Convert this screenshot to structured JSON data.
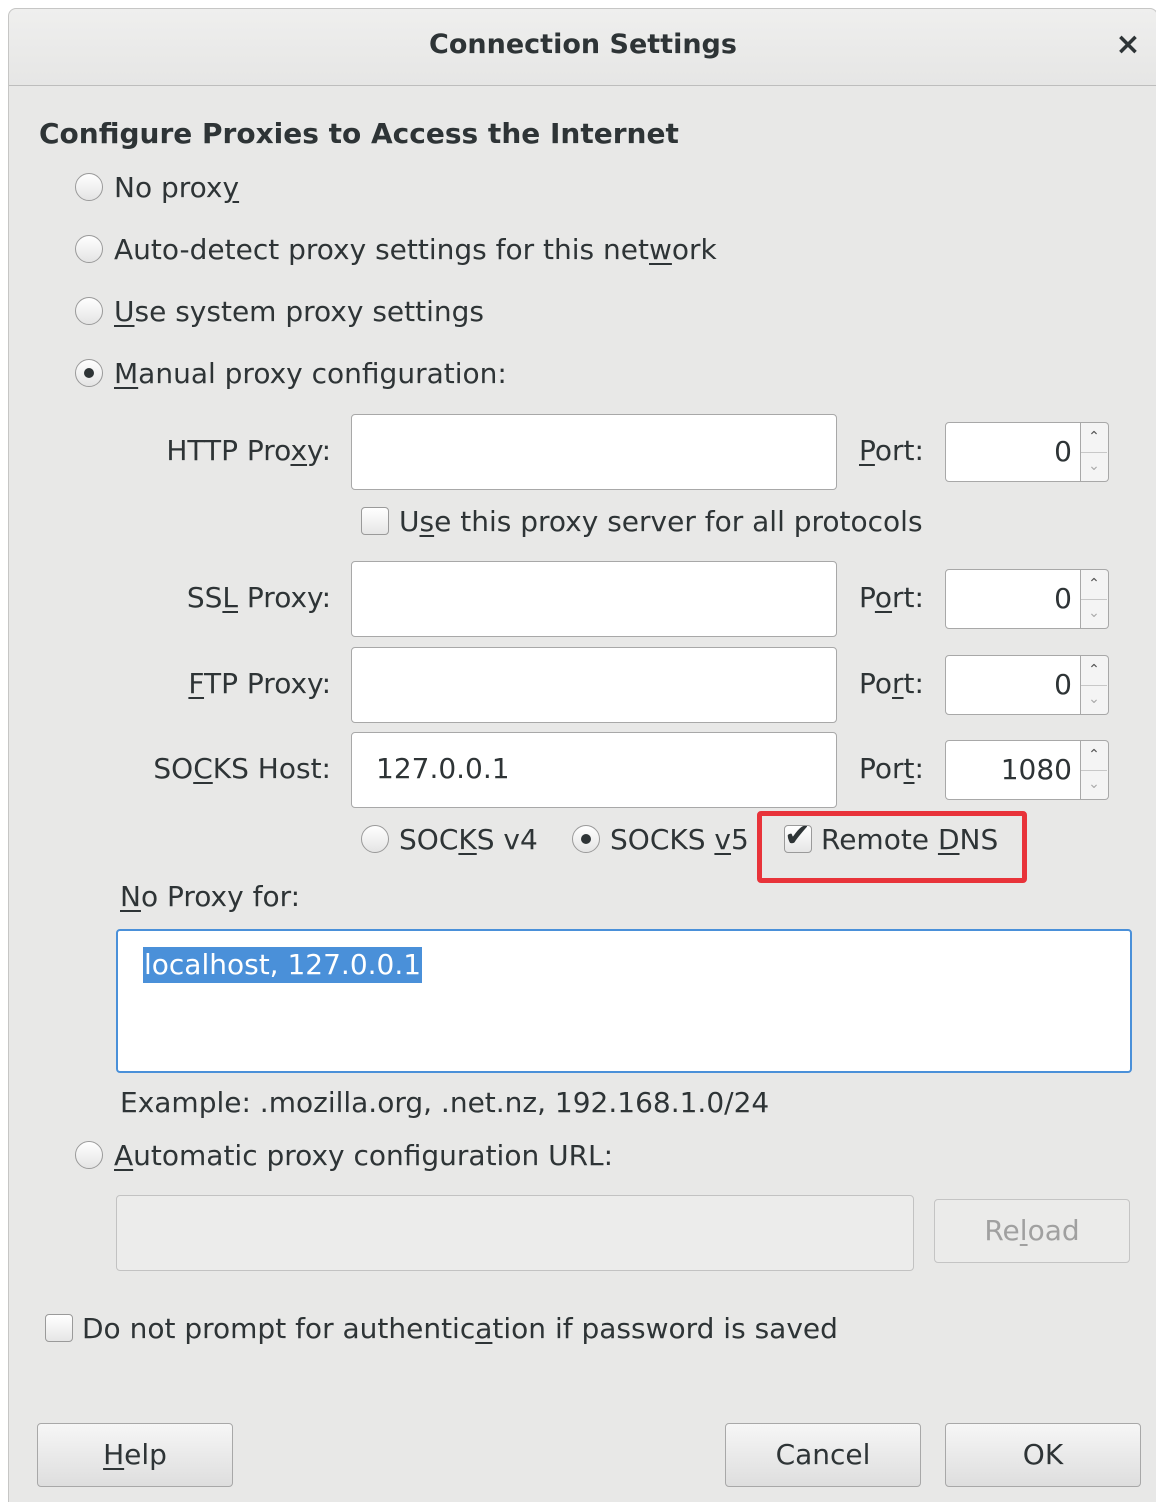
{
  "window": {
    "title": "Connection Settings",
    "close_glyph": "×"
  },
  "heading": "Configure Proxies to Access the Internet",
  "proxy_modes": {
    "no_proxy": {
      "label_pre": "No prox",
      "label_ul": "y",
      "label_post": "",
      "selected": false
    },
    "auto_detect": {
      "label_pre": "Auto-detect proxy settings for this net",
      "label_ul": "w",
      "label_post": "ork",
      "selected": false
    },
    "system": {
      "label_pre": "",
      "label_ul": "U",
      "label_post": "se system proxy settings",
      "selected": false
    },
    "manual": {
      "label_pre": "",
      "label_ul": "M",
      "label_post": "anual proxy configuration:",
      "selected": true
    },
    "auto_url": {
      "label_pre": "",
      "label_ul": "A",
      "label_post": "utomatic proxy configuration URL:",
      "selected": false
    }
  },
  "http": {
    "label_pre": "HTTP Pro",
    "label_ul": "x",
    "label_post": "y:",
    "value": "",
    "port_pre": "",
    "port_ul": "P",
    "port_post": "ort:",
    "port": "0"
  },
  "use_for_all": {
    "label_pre": "U",
    "label_ul": "s",
    "label_post": "e this proxy server for all protocols",
    "checked": false
  },
  "ssl": {
    "label_pre": "SS",
    "label_ul": "L",
    "label_post": " Proxy:",
    "value": "",
    "port_pre": "P",
    "port_ul": "o",
    "port_post": "rt:",
    "port": "0"
  },
  "ftp": {
    "label_pre": "",
    "label_ul": "F",
    "label_post": "TP Proxy:",
    "value": "",
    "port_pre": "Po",
    "port_ul": "r",
    "port_post": "t:",
    "port": "0"
  },
  "socks": {
    "label_pre": "SO",
    "label_ul": "C",
    "label_post": "KS Host:",
    "value": "127.0.0.1",
    "port_pre": "Por",
    "port_ul": "t",
    "port_post": ":",
    "port": "1080"
  },
  "socks_version": {
    "v4": {
      "label_pre": "SOC",
      "label_ul": "K",
      "label_post": "S v4",
      "selected": false
    },
    "v5": {
      "label_pre": "SOCKS ",
      "label_ul": "v",
      "label_post": "5",
      "selected": true
    }
  },
  "remote_dns": {
    "label_pre": "Remote ",
    "label_ul": "D",
    "label_post": "NS",
    "checked": true
  },
  "no_proxy_for": {
    "label_pre": "",
    "label_ul": "N",
    "label_post": "o Proxy for:",
    "value": "localhost, 127.0.0.1"
  },
  "example": "Example: .mozilla.org, .net.nz, 192.168.1.0/24",
  "auto_url_value": "",
  "reload": {
    "label_pre": "Re",
    "label_ul": "l",
    "label_post": "oad"
  },
  "auth_prompt": {
    "label_pre": "Do not prompt for authentic",
    "label_ul": "a",
    "label_post": "tion if password is saved",
    "checked": false
  },
  "buttons": {
    "help": {
      "label_pre": "",
      "label_ul": "H",
      "label_post": "elp"
    },
    "cancel": "Cancel",
    "ok": "OK"
  },
  "colors": {
    "selection": "#4a90d9",
    "highlight_box": "#e8333a",
    "dialog_bg": "#e8e8e7"
  },
  "icons": {
    "checkmark": "✔",
    "spin_up": "⌃",
    "spin_down": "⌄"
  }
}
